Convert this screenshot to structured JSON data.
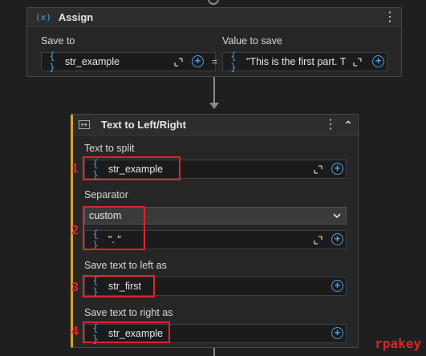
{
  "assign": {
    "icon_glyph": "(x)",
    "title": "Assign",
    "save_to_label": "Save to",
    "save_to_value": "str_example",
    "equals": "=",
    "value_label": "Value to save",
    "value_value": "\"This is the first part. T"
  },
  "split": {
    "title": "Text to Left/Right",
    "collapse_glyph": "⌃",
    "text_label": "Text to split",
    "text_value": "str_example",
    "separator_label": "Separator",
    "separator_selected": "custom",
    "separator_value": "\". \"",
    "left_label": "Save text to left as",
    "left_value": "str_first",
    "right_label": "Save text to right as",
    "right_value": "str_example"
  },
  "var_icon_glyph": "{ }",
  "plus_glyph": "+",
  "kebab_glyph": "⋮",
  "annotations": [
    "1",
    "2",
    "3",
    "4"
  ],
  "watermark": "rpakey",
  "colors": {
    "accent_blue": "#4aa3e8",
    "annotation_red": "#e0242b",
    "watermark_red": "#d8262b"
  }
}
